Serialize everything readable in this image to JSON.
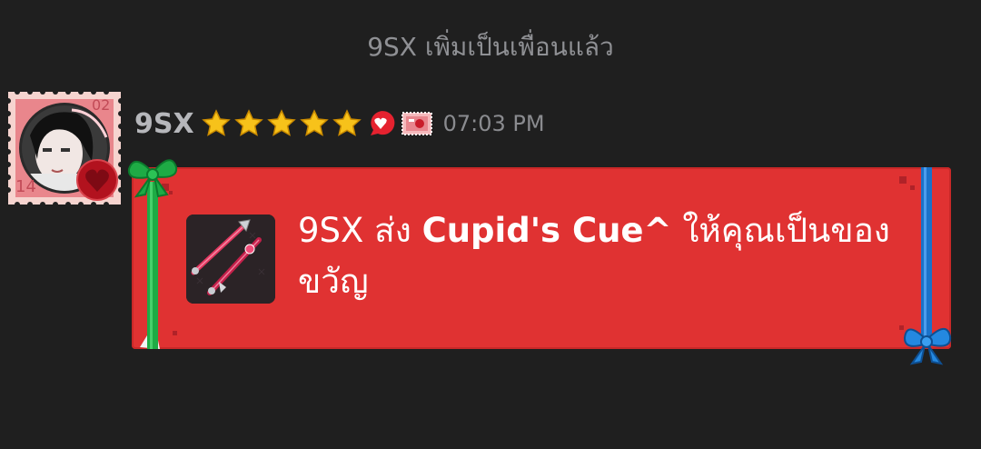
{
  "system_message": "9SX เพิ่มเป็นเพื่อนแล้ว",
  "avatar": {
    "stamp_number_top": "02",
    "stamp_number_bottom": "14"
  },
  "sender": {
    "name": "9SX",
    "star_count": 5,
    "timestamp": "07:03 PM"
  },
  "gift_message": {
    "sender": "9SX",
    "verb": "ส่ง",
    "item_name": "Cupid's Cue^",
    "suffix": "ให้คุณเป็นของขวัญ"
  },
  "colors": {
    "background": "#1f1f1f",
    "card_red": "#e03232",
    "ribbon_green": "#1eab45",
    "ribbon_blue": "#1a72c9",
    "star_gold": "#f7c21a"
  },
  "icons": {
    "star": "star-icon",
    "heart_badge": "heart-badge-icon",
    "stamp_badge": "stamp-badge-icon",
    "green_bow": "green-bow-icon",
    "blue_bow": "blue-bow-icon",
    "item": "cue-stick-icon"
  }
}
